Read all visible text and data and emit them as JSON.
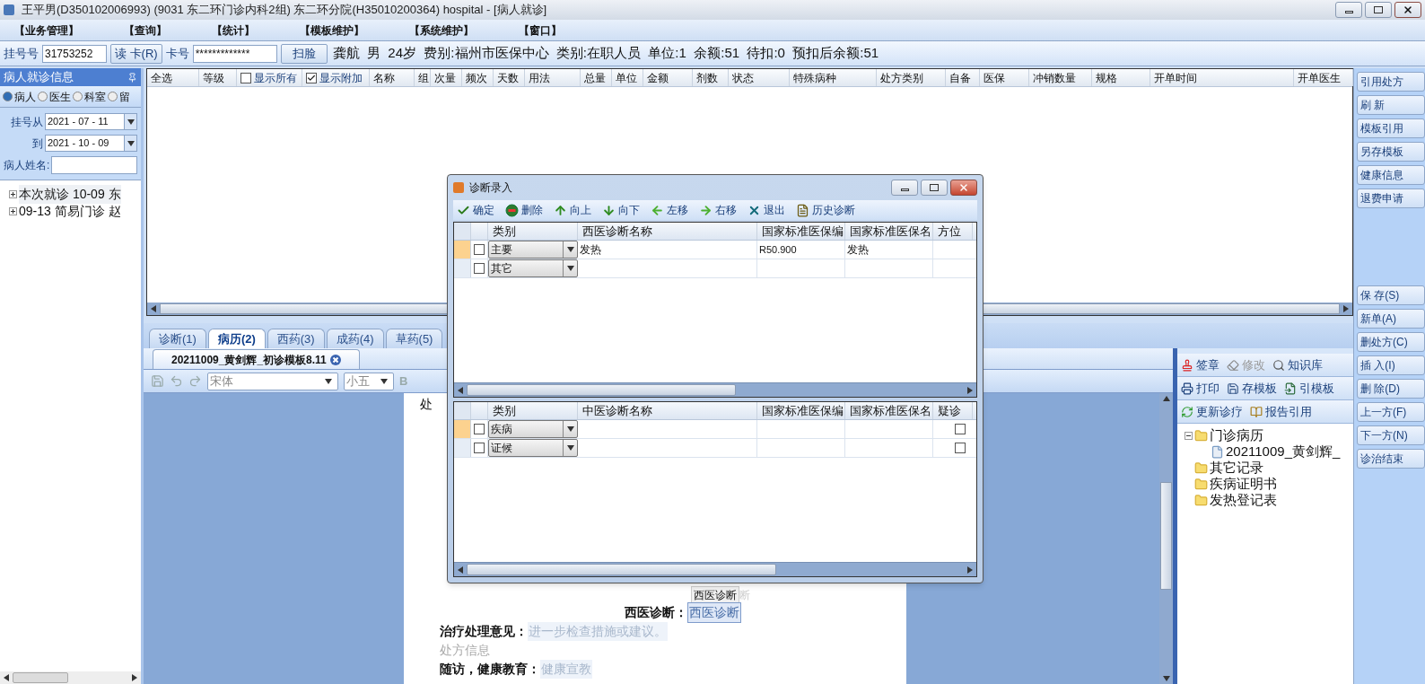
{
  "window": {
    "title": "王平男(D350102006993) (9031 东二环门诊内科2组) 东二环分院(H35010200364) hospital - [病人就诊]"
  },
  "menu": [
    "【业务管理】",
    "【查询】",
    "【统计】",
    "【模板维护】",
    "【系统维护】",
    "【窗口】"
  ],
  "patient_bar": {
    "reg_label": "挂号号",
    "reg_value": "31753252",
    "read_card": "读 卡(R)",
    "card_label": "卡号",
    "card_value": "*************",
    "scan": "扫脸",
    "summary": "龚航  男  24岁  费别:福州市医保中心  类别:在职人员  单位:1  余额:51  待扣:0  预扣后余额:51"
  },
  "left_panel": {
    "title": "病人就诊信息",
    "radios": [
      {
        "label": "病人",
        "selected": true
      },
      {
        "label": "医生",
        "selected": false
      },
      {
        "label": "科室",
        "selected": false
      },
      {
        "label": "留",
        "selected": false
      }
    ],
    "from_label": "挂号从",
    "from_value": "2021 - 07 - 11",
    "to_label": "到",
    "to_value": "2021 - 10 - 09",
    "name_label": "病人姓名:",
    "visits": [
      {
        "text": "本次就诊 10-09 东",
        "selected": true
      },
      {
        "text": "09-13 简易门诊 赵",
        "selected": false
      }
    ]
  },
  "orders_table": {
    "columns": [
      {
        "kind": "text",
        "label": "全选"
      },
      {
        "kind": "text",
        "label": "等级"
      },
      {
        "kind": "checkbox",
        "label": "显示所有",
        "checked": false
      },
      {
        "kind": "checkbox",
        "label": "显示附加",
        "checked": true
      },
      {
        "kind": "text",
        "label": "名称"
      },
      {
        "kind": "text",
        "label": "组"
      },
      {
        "kind": "text",
        "label": "次量"
      },
      {
        "kind": "text",
        "label": "频次"
      },
      {
        "kind": "text",
        "label": "天数"
      },
      {
        "kind": "text",
        "label": "用法"
      },
      {
        "kind": "text",
        "label": "总量"
      },
      {
        "kind": "text",
        "label": "单位"
      },
      {
        "kind": "text",
        "label": "金额"
      },
      {
        "kind": "text",
        "label": "剂数"
      },
      {
        "kind": "text",
        "label": "状态"
      },
      {
        "kind": "text",
        "label": "特殊病种"
      },
      {
        "kind": "text",
        "label": "处方类别"
      },
      {
        "kind": "text",
        "label": "自备"
      },
      {
        "kind": "text",
        "label": "医保"
      },
      {
        "kind": "text",
        "label": "冲销数量"
      },
      {
        "kind": "text",
        "label": "规格"
      },
      {
        "kind": "text",
        "label": "开单时间"
      },
      {
        "kind": "text",
        "label": "开单医生"
      }
    ]
  },
  "side_buttons_top": [
    "引用处方",
    "刷 新",
    "模板引用",
    "另存模板",
    "健康信息",
    "退费申请"
  ],
  "side_buttons_bottom": [
    "保 存(S)",
    "新单(A)",
    "删处方(C)",
    "插 入(I)",
    "删 除(D)",
    "上一方(F)",
    "下一方(N)",
    "诊治结束"
  ],
  "tabs": [
    {
      "label": "诊断(1)",
      "selected": false
    },
    {
      "label": "病历(2)",
      "selected": true
    },
    {
      "label": "西药(3)",
      "selected": false
    },
    {
      "label": "成药(4)",
      "selected": false
    },
    {
      "label": "草药(5)",
      "selected": false
    }
  ],
  "doc_tab": {
    "label": "20211009_黄剑辉_初诊模板8.11"
  },
  "editor_toolbar": {
    "font": "宋体",
    "size": "小五",
    "bold": "B"
  },
  "document": {
    "top_text": "处",
    "hint": "西医诊断",
    "hint_ghost": "断",
    "lines": [
      {
        "kind": "field",
        "label": "西医诊断：",
        "placeholder": "西医诊断",
        "selected": true
      },
      {
        "kind": "field",
        "label": "治疗处理意见：",
        "placeholder": "进一步检查措施或建议。",
        "selected": false
      },
      {
        "kind": "plain",
        "label": "处方信息"
      },
      {
        "kind": "field",
        "label": "随访，健康教育：",
        "placeholder": "健康宣教",
        "selected": false
      }
    ]
  },
  "record_pane": {
    "toolbar_rows": [
      [
        {
          "label": "签章",
          "disabled": false
        },
        {
          "label": "修改",
          "disabled": true
        },
        {
          "label": "知识库",
          "disabled": false
        }
      ],
      [
        {
          "label": "打印",
          "disabled": false
        },
        {
          "label": "存模板",
          "disabled": false
        },
        {
          "label": "引模板",
          "disabled": false
        }
      ],
      [
        {
          "label": "更新诊疗",
          "disabled": false
        },
        {
          "label": "报告引用",
          "disabled": false
        }
      ]
    ],
    "tree": [
      {
        "label": "门诊病历",
        "kind": "folder",
        "expanded": true,
        "children": [
          {
            "label": "20211009_黄剑辉_",
            "kind": "file"
          }
        ]
      },
      {
        "label": "其它记录",
        "kind": "folder"
      },
      {
        "label": "疾病证明书",
        "kind": "folder"
      },
      {
        "label": "发热登记表",
        "kind": "folder"
      }
    ]
  },
  "dialog": {
    "title": "诊断录入",
    "toolbar": [
      "确定",
      "删除",
      "向上",
      "向下",
      "左移",
      "右移",
      "退出",
      "历史诊断"
    ],
    "western": {
      "columns": [
        "类别",
        "西医诊断名称",
        "国家标准医保编",
        "国家标准医保名",
        "方位"
      ],
      "rows": [
        {
          "selected": true,
          "checked": false,
          "category": "主要",
          "name": "发热",
          "code": "R50.900",
          "insurance_name": "发热"
        },
        {
          "selected": false,
          "checked": false,
          "category": "其它"
        }
      ]
    },
    "chinese": {
      "columns": [
        "类别",
        "中医诊断名称",
        "国家标准医保编",
        "国家标准医保名",
        "疑诊"
      ],
      "rows": [
        {
          "selected": true,
          "checked": false,
          "category": "疾病",
          "suspected": false
        },
        {
          "selected": false,
          "checked": false,
          "category": "证候",
          "suspected": false
        }
      ]
    }
  }
}
